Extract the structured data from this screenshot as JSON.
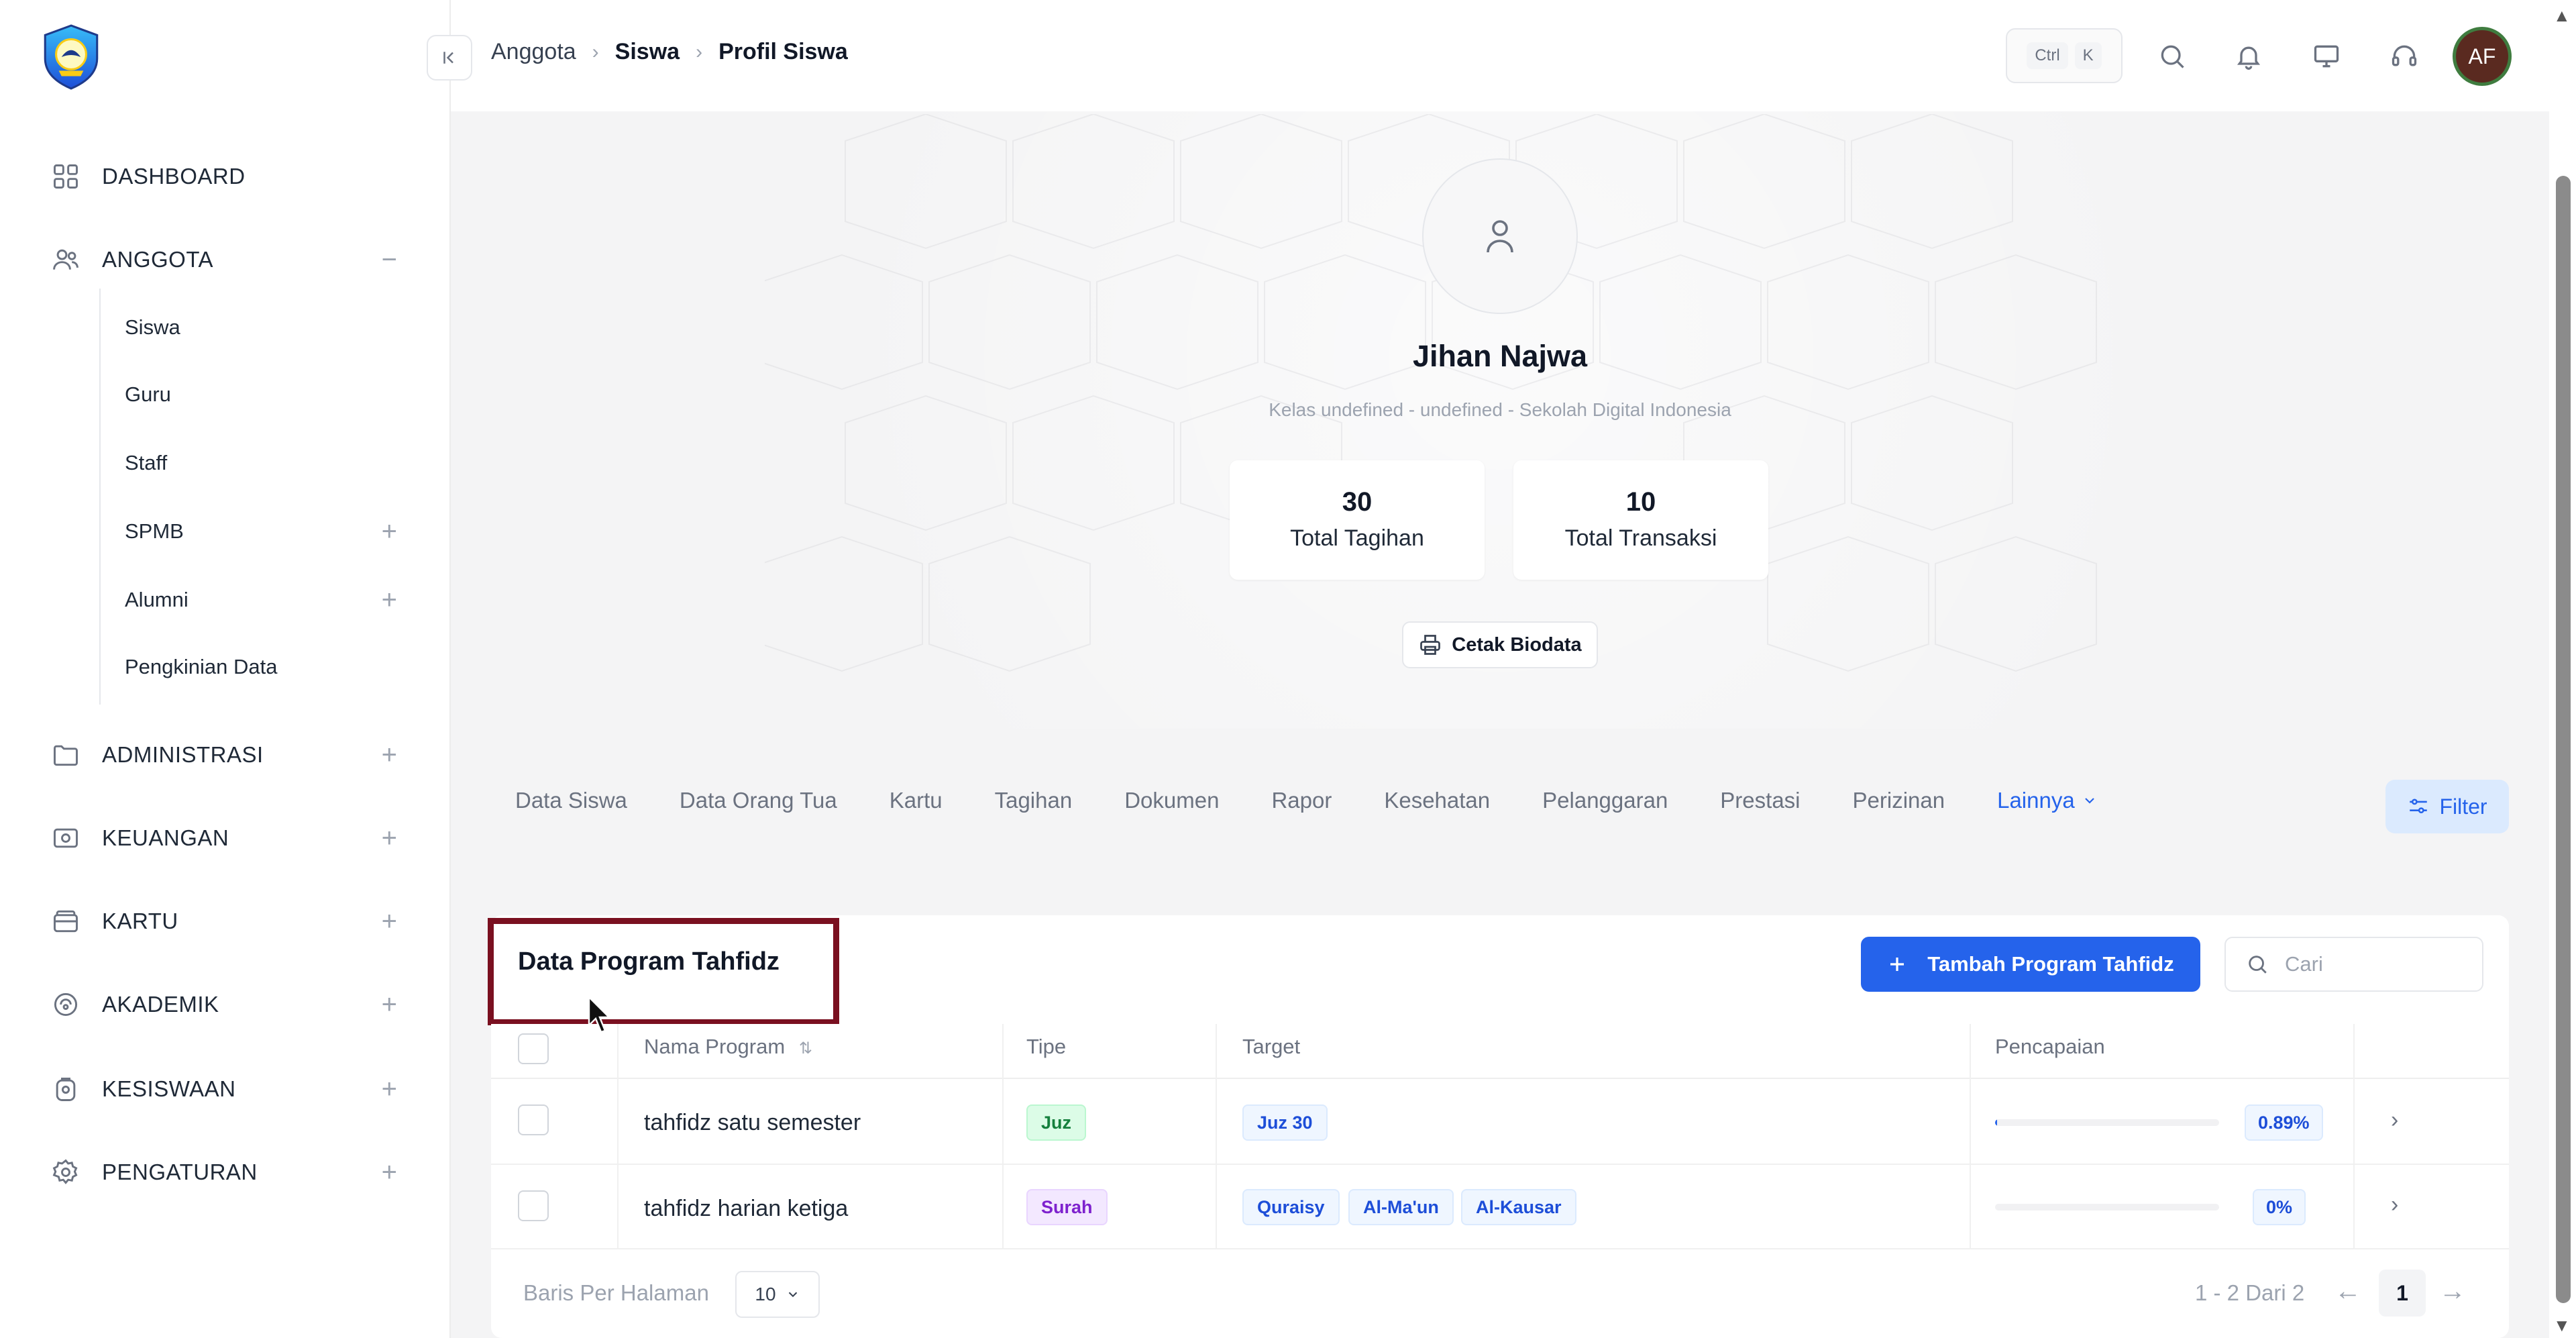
{
  "sidebar": {
    "items": [
      {
        "label": "DASHBOARD",
        "icon": "dashboard-grid-icon",
        "toggle": ""
      },
      {
        "label": "ANGGOTA",
        "icon": "users-icon",
        "toggle": "−"
      },
      {
        "label": "ADMINISTRASI",
        "icon": "folder-icon",
        "toggle": "+"
      },
      {
        "label": "KEUANGAN",
        "icon": "money-icon",
        "toggle": "+"
      },
      {
        "label": "KARTU",
        "icon": "card-icon",
        "toggle": "+"
      },
      {
        "label": "AKADEMIK",
        "icon": "academic-icon",
        "toggle": "+"
      },
      {
        "label": "KESISWAAN",
        "icon": "student-icon",
        "toggle": "+"
      },
      {
        "label": "PENGATURAN",
        "icon": "settings-icon",
        "toggle": "+"
      }
    ],
    "sub_items": [
      {
        "label": "Siswa",
        "toggle": ""
      },
      {
        "label": "Guru",
        "toggle": ""
      },
      {
        "label": "Staff",
        "toggle": ""
      },
      {
        "label": "SPMB",
        "toggle": "+"
      },
      {
        "label": "Alumni",
        "toggle": "+"
      },
      {
        "label": "Pengkinian Data",
        "toggle": ""
      }
    ]
  },
  "breadcrumb": {
    "item1": "Anggota",
    "item2": "Siswa",
    "item3": "Profil Siswa"
  },
  "topbar": {
    "kbd_ctrl": "Ctrl",
    "kbd_k": "K",
    "avatar_initials": "AF"
  },
  "profile": {
    "name": "Jihan Najwa",
    "subtitle": "Kelas undefined - undefined - Sekolah Digital Indonesia",
    "stats": [
      {
        "value": "30",
        "label": "Total Tagihan"
      },
      {
        "value": "10",
        "label": "Total Transaksi"
      }
    ],
    "print_button": "Cetak Biodata"
  },
  "tabs": {
    "items": [
      "Data Siswa",
      "Data Orang Tua",
      "Kartu",
      "Tagihan",
      "Dokumen",
      "Rapor",
      "Kesehatan",
      "Pelanggaran",
      "Prestasi",
      "Perizinan"
    ],
    "more": "Lainnya",
    "filter": "Filter"
  },
  "table_card": {
    "title": "Data Program Tahfidz",
    "add_button": "Tambah Program Tahfidz",
    "search_placeholder": "Cari",
    "columns": {
      "name": "Nama Program",
      "type": "Tipe",
      "target": "Target",
      "achievement": "Pencapaian"
    },
    "rows": [
      {
        "name": "tahfidz satu semester",
        "type": "Juz",
        "targets": [
          "Juz 30"
        ],
        "percent_label": "0.89%",
        "progress": 0.0089
      },
      {
        "name": "tahfidz harian ketiga",
        "type": "Surah",
        "targets": [
          "Quraisy",
          "Al-Ma'un",
          "Al-Kausar"
        ],
        "percent_label": "0%",
        "progress": 0
      }
    ],
    "footer": {
      "rows_per_page_label": "Baris Per Halaman",
      "rows_per_page": "10",
      "range": "1 - 2 Dari 2",
      "current_page": "1"
    }
  },
  "colors": {
    "accent": "#2563eb",
    "highlight_box": "#7a1020",
    "avatar_bg": "#5a2a20",
    "avatar_ring": "#3f7c3f"
  }
}
